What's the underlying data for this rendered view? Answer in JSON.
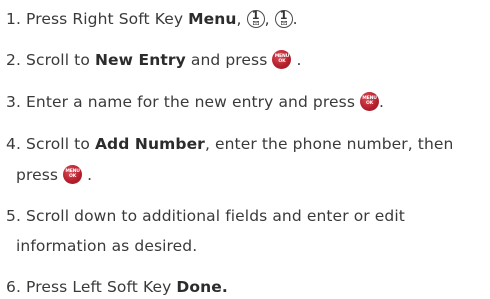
{
  "steps": [
    {
      "number": "1.",
      "text_a": "Press Right Soft Key ",
      "bold_a": "Menu",
      "text_b": ",",
      "text_c": ",",
      "text_d": "."
    },
    {
      "number": "2.",
      "text_a": "Scroll to ",
      "bold_a": "New Entry",
      "text_b": " and press",
      "text_c": "."
    },
    {
      "number": "3.",
      "text_a": "Enter a name for the new entry and press",
      "text_b": "."
    },
    {
      "number": "4.",
      "text_a": "Scroll to ",
      "bold_a": "Add Number",
      "text_b": ", enter the phone number, then",
      "cont_a": "press",
      "cont_b": "."
    },
    {
      "number": "5.",
      "text_a": "Scroll down to additional fields and enter or edit",
      "cont_a": "information as desired."
    },
    {
      "number": "6.",
      "text_a": "Press Left Soft Key ",
      "bold_a": "Done."
    }
  ],
  "icons": {
    "key_one": {
      "digit": "1",
      "name": "key-1-voicemail-icon"
    },
    "menu_ok": {
      "line1": "MENU",
      "line2": "OK",
      "name": "menu-ok-button-icon",
      "color": "#b8202e"
    }
  }
}
